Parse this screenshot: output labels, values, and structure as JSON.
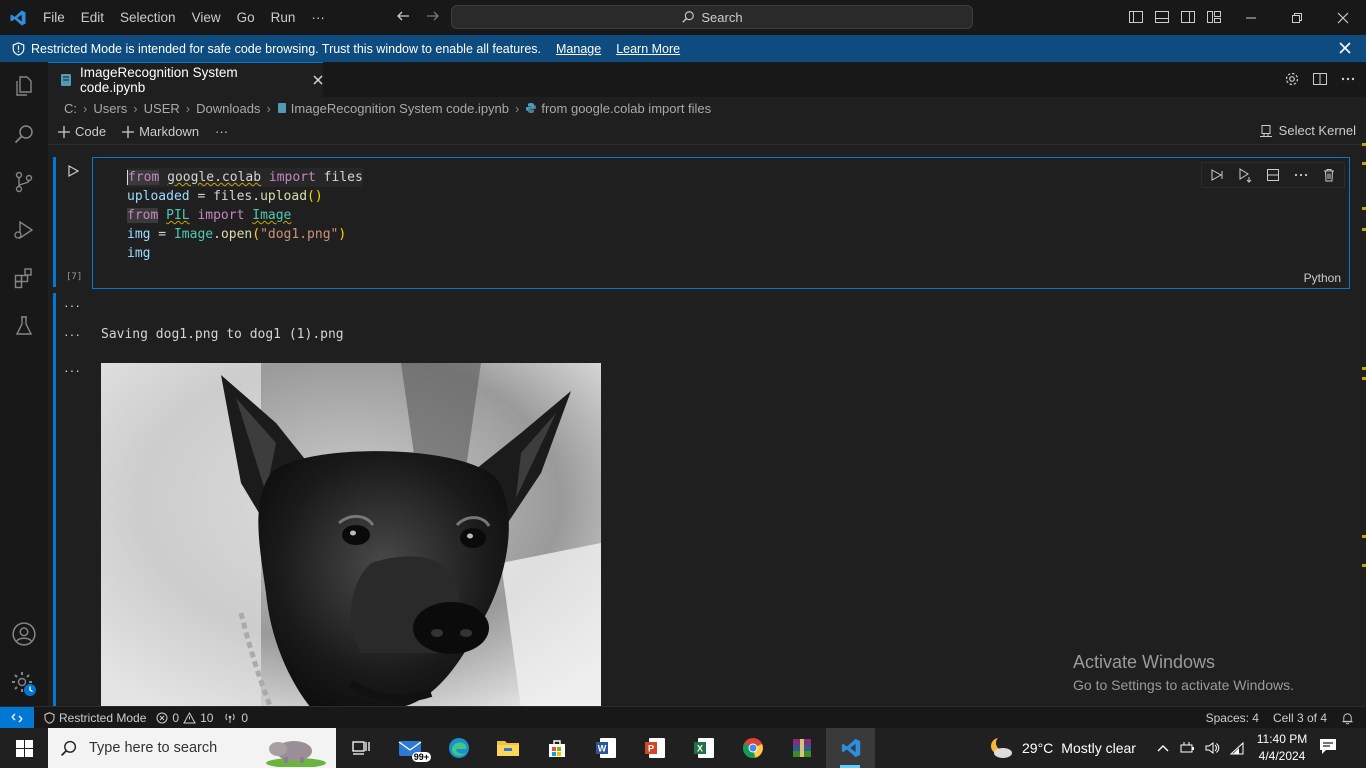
{
  "titlebar": {
    "menu": [
      "File",
      "Edit",
      "Selection",
      "View",
      "Go",
      "Run",
      "···"
    ],
    "search_label": "Search"
  },
  "banner": {
    "message": "Restricted Mode is intended for safe code browsing. Trust this window to enable all features.",
    "manage": "Manage",
    "learn_more": "Learn More"
  },
  "tab": {
    "label": "ImageRecognition System code.ipynb"
  },
  "breadcrumb": {
    "parts": [
      "C:",
      "Users",
      "USER",
      "Downloads",
      "ImageRecognition System code.ipynb",
      "from google.colab import files"
    ]
  },
  "nbtoolbar": {
    "code": "Code",
    "markdown": "Markdown",
    "more": "···",
    "kernel": "Select Kernel"
  },
  "cell": {
    "exec_count": "[7]",
    "language": "Python",
    "lines": [
      "from google.colab import files",
      "uploaded = files.upload()",
      "from PIL import Image",
      "img = Image.open(\"dog1.png\")",
      "img"
    ]
  },
  "output": {
    "dots": "···",
    "text": "Saving dog1.png to dog1 (1).png"
  },
  "watermark": {
    "title": "Activate Windows",
    "subtitle": "Go to Settings to activate Windows."
  },
  "statusbar": {
    "restricted": "Restricted Mode",
    "errors": "0",
    "warnings": "10",
    "ports": "0",
    "spaces": "Spaces: 4",
    "cell": "Cell 3 of 4"
  },
  "taskbar": {
    "search_placeholder": "Type here to search",
    "mail_badge": "99+",
    "weather_temp": "29°C",
    "weather_desc": "Mostly clear",
    "time": "11:40 PM",
    "date": "4/4/2024"
  },
  "colors": {
    "accent": "#0078d4",
    "banner": "#0e4c7f",
    "background": "#1f1f1f"
  }
}
